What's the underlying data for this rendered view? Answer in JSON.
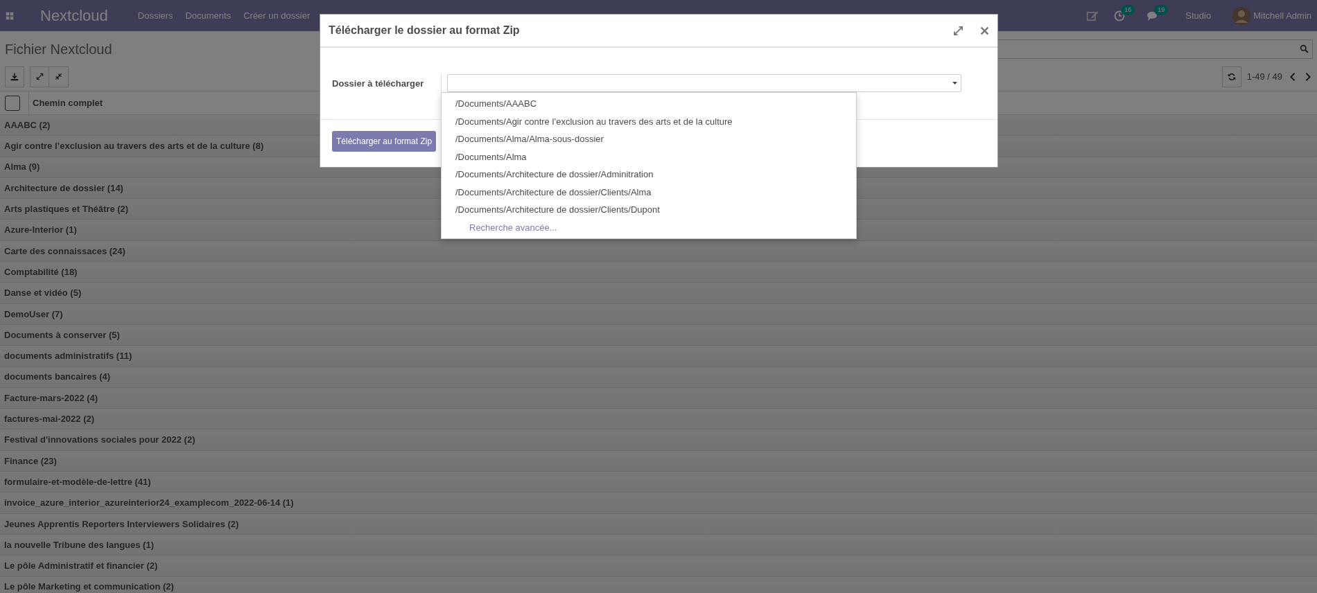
{
  "navbar": {
    "app_name": "Nextcloud",
    "menu": [
      "Dossiers",
      "Documents",
      "Créer un dossier"
    ],
    "activity_count": "16",
    "message_count": "19",
    "studio": "Studio",
    "user": "Mitchell Admin"
  },
  "page": {
    "title": "Fichier Nextcloud",
    "pager": "1-49 / 49"
  },
  "table": {
    "select_all": {
      "checked": false
    },
    "columns": [
      "Chemin complet"
    ],
    "groups": [
      "AAABC (2)",
      "Agir contre l’exclusion au travers des arts et de la culture (8)",
      "Alma (9)",
      "Architecture de dossier (14)",
      "Arts plastiques et Théâtre (2)",
      "Azure-Interior (1)",
      "Carte des connaissaces (24)",
      "Comptabilité (18)",
      "Danse et vidéo (5)",
      "DemoUser (7)",
      "Documents à conserver (5)",
      "documents administratifs (11)",
      "documents bancaires (4)",
      "Facture-mars-2022 (4)",
      "factures-mai-2022 (2)",
      "Festival d'innovations sociales pour 2022 (2)",
      "Finance (23)",
      "formulaire-et-modèle-de-lettre (41)",
      "invoice_azure_interior_azureinterior24_examplecom_2022-06-14 (1)",
      "Jeunes Apprentis Reporters Interviewers Solidaires (2)",
      "la nouvelle Tribune des langues (1)",
      "Le pôle Administratif et financier (2)",
      "Le pôle Marketing et communication (2)"
    ]
  },
  "dialog": {
    "title": "Télécharger le dossier au format Zip",
    "field_label": "Dossier à télécharger",
    "options": [
      "/Documents/AAABC",
      "/Documents/Agir contre l’exclusion au travers des arts et de la culture",
      "/Documents/Alma/Alma-sous-dossier",
      "/Documents/Alma",
      "/Documents/Architecture de dossier/Adminitration",
      "/Documents/Architecture de dossier/Clients/Alma",
      "/Documents/Architecture de dossier/Clients/Dupont"
    ],
    "advanced_search": "Recherche avancée...",
    "submit": "Télécharger au format Zip"
  }
}
